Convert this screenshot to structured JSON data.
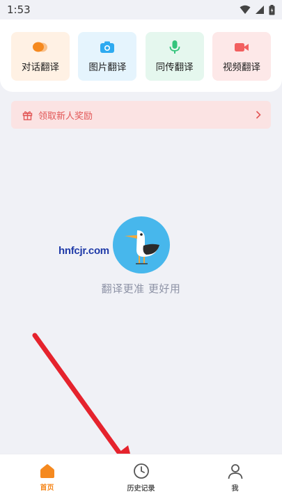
{
  "status_bar": {
    "time": "1:53",
    "icons": [
      "wifi-icon",
      "signal-icon",
      "battery-icon"
    ]
  },
  "features": [
    {
      "label": "对话翻译",
      "icon": "chat-bubbles-icon",
      "bg": "#fff1e4",
      "color": "#f5891f"
    },
    {
      "label": "图片翻译",
      "icon": "camera-icon",
      "bg": "#e5f4fd",
      "color": "#2eaaf0"
    },
    {
      "label": "同传翻译",
      "icon": "microphone-icon",
      "bg": "#e5f7ee",
      "color": "#34c47c"
    },
    {
      "label": "视频翻译",
      "icon": "video-camera-icon",
      "bg": "#fde8e8",
      "color": "#f25f5f"
    }
  ],
  "promo": {
    "label": "领取新人奖励",
    "icon": "gift-icon",
    "color": "#e25656"
  },
  "empty_state": {
    "text": "翻译更准 更好用",
    "icon": "seagull-icon"
  },
  "watermark": "hnfcjr.com",
  "bottom_nav": [
    {
      "label": "首页",
      "icon": "home-icon",
      "active": true,
      "color": "#f5891f"
    },
    {
      "label": "历史记录",
      "icon": "clock-icon",
      "active": false,
      "color": "#555555"
    },
    {
      "label": "我",
      "icon": "person-icon",
      "active": false,
      "color": "#555555"
    }
  ]
}
